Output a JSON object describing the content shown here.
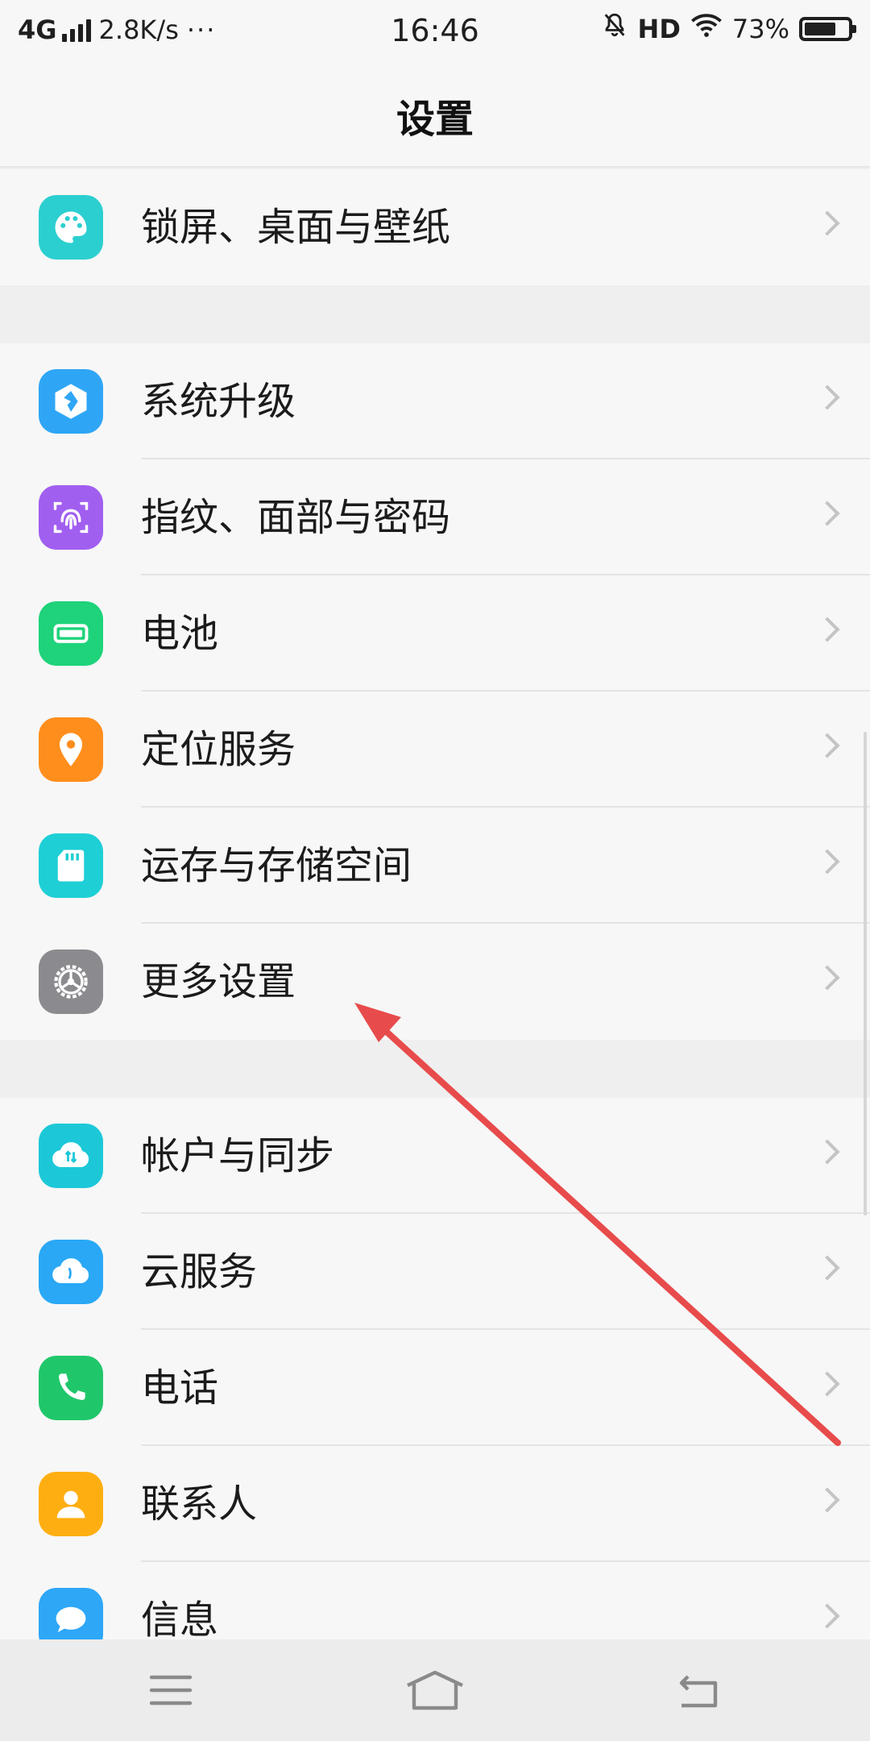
{
  "status_bar": {
    "network": "4G",
    "speed": "2.8K/s",
    "more": "···",
    "time": "16:46",
    "hd": "HD",
    "battery_pct": "73%",
    "battery_level": 0.73,
    "icons": [
      "signal-icon",
      "mute-bell-icon",
      "wifi-icon",
      "battery-icon"
    ]
  },
  "header": {
    "title": "设置"
  },
  "groups": [
    {
      "items": [
        {
          "label": "锁屏、桌面与壁纸",
          "icon": "palette-icon",
          "color": "#2ccfd0"
        }
      ]
    },
    {
      "items": [
        {
          "label": "系统升级",
          "icon": "system-update-icon",
          "color": "#2fa6f5"
        },
        {
          "label": "指纹、面部与密码",
          "icon": "fingerprint-icon",
          "color": "#a15ff0"
        },
        {
          "label": "电池",
          "icon": "battery-icon",
          "color": "#1ed37a"
        },
        {
          "label": "定位服务",
          "icon": "location-pin-icon",
          "color": "#ff8e1c"
        },
        {
          "label": "运存与存储空间",
          "icon": "sd-card-icon",
          "color": "#1ecfd6"
        },
        {
          "label": "更多设置",
          "icon": "gear-icon",
          "color": "#8b8b8f"
        }
      ]
    },
    {
      "items": [
        {
          "label": "帐户与同步",
          "icon": "cloud-sync-icon",
          "color": "#1cc8d8"
        },
        {
          "label": "云服务",
          "icon": "cloud-icon",
          "color": "#2aa8f5"
        },
        {
          "label": "电话",
          "icon": "phone-icon",
          "color": "#20c76a"
        },
        {
          "label": "联系人",
          "icon": "contact-icon",
          "color": "#ffae12"
        },
        {
          "label": "信息",
          "icon": "message-icon",
          "color": "#2ea7f7"
        }
      ]
    }
  ],
  "annotation": {
    "color": "#e84b4b",
    "points_to": "更多设置"
  },
  "nav_bar": {
    "buttons": [
      "menu-icon",
      "home-icon",
      "back-icon"
    ]
  }
}
